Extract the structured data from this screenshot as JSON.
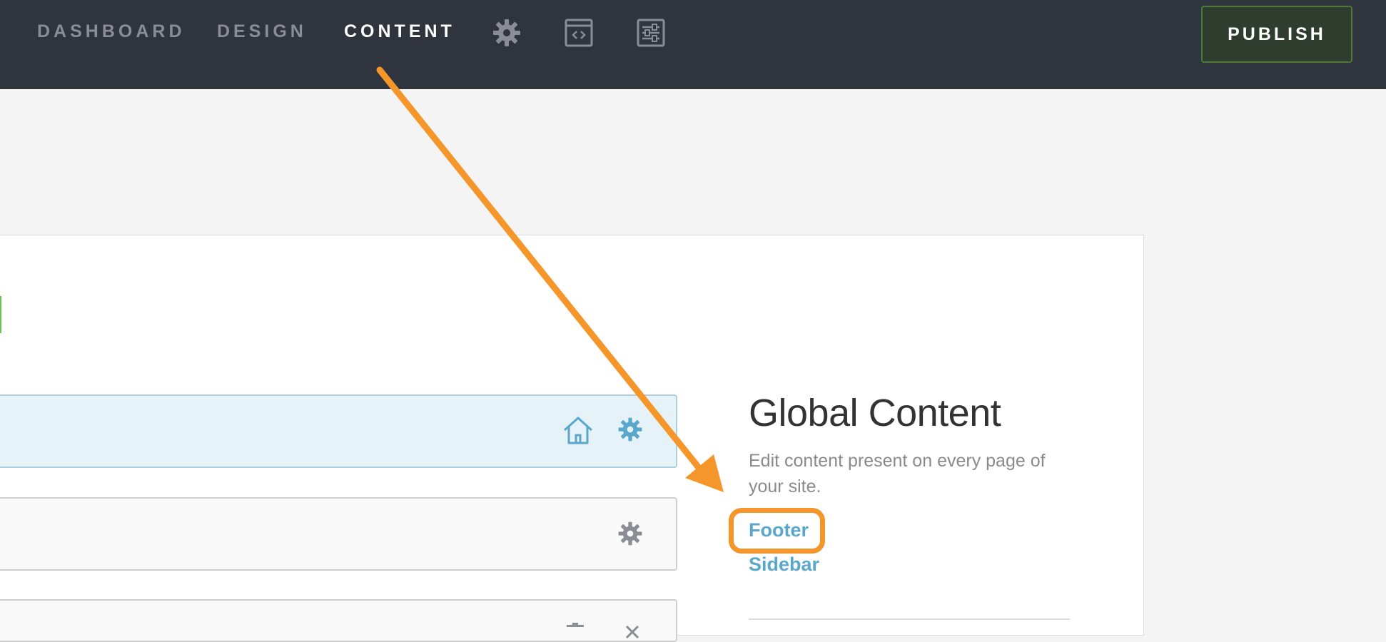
{
  "topbar": {
    "nav": [
      {
        "label": "DASHBOARD",
        "active": false
      },
      {
        "label": "DESIGN",
        "active": false
      },
      {
        "label": "CONTENT",
        "active": true
      }
    ],
    "icons": [
      "gear-icon",
      "code-window-icon",
      "sliders-icon"
    ],
    "publish_label": "PUBLISH"
  },
  "pages": {
    "rows": [
      {
        "icons": [
          "home-icon",
          "gear-icon"
        ]
      },
      {
        "icons": [
          "gear-icon"
        ]
      },
      {
        "icons": [
          "trash-icon",
          "close-icon"
        ]
      }
    ]
  },
  "global_content": {
    "title": "Global Content",
    "description": "Edit content present on every page of your site.",
    "links": [
      "Footer",
      "Sidebar"
    ]
  },
  "colors": {
    "topbar": "#30343c",
    "accent_link": "#5aa7cc",
    "annotation": "#f5962b",
    "publish_bg": "#2f3d2f"
  }
}
